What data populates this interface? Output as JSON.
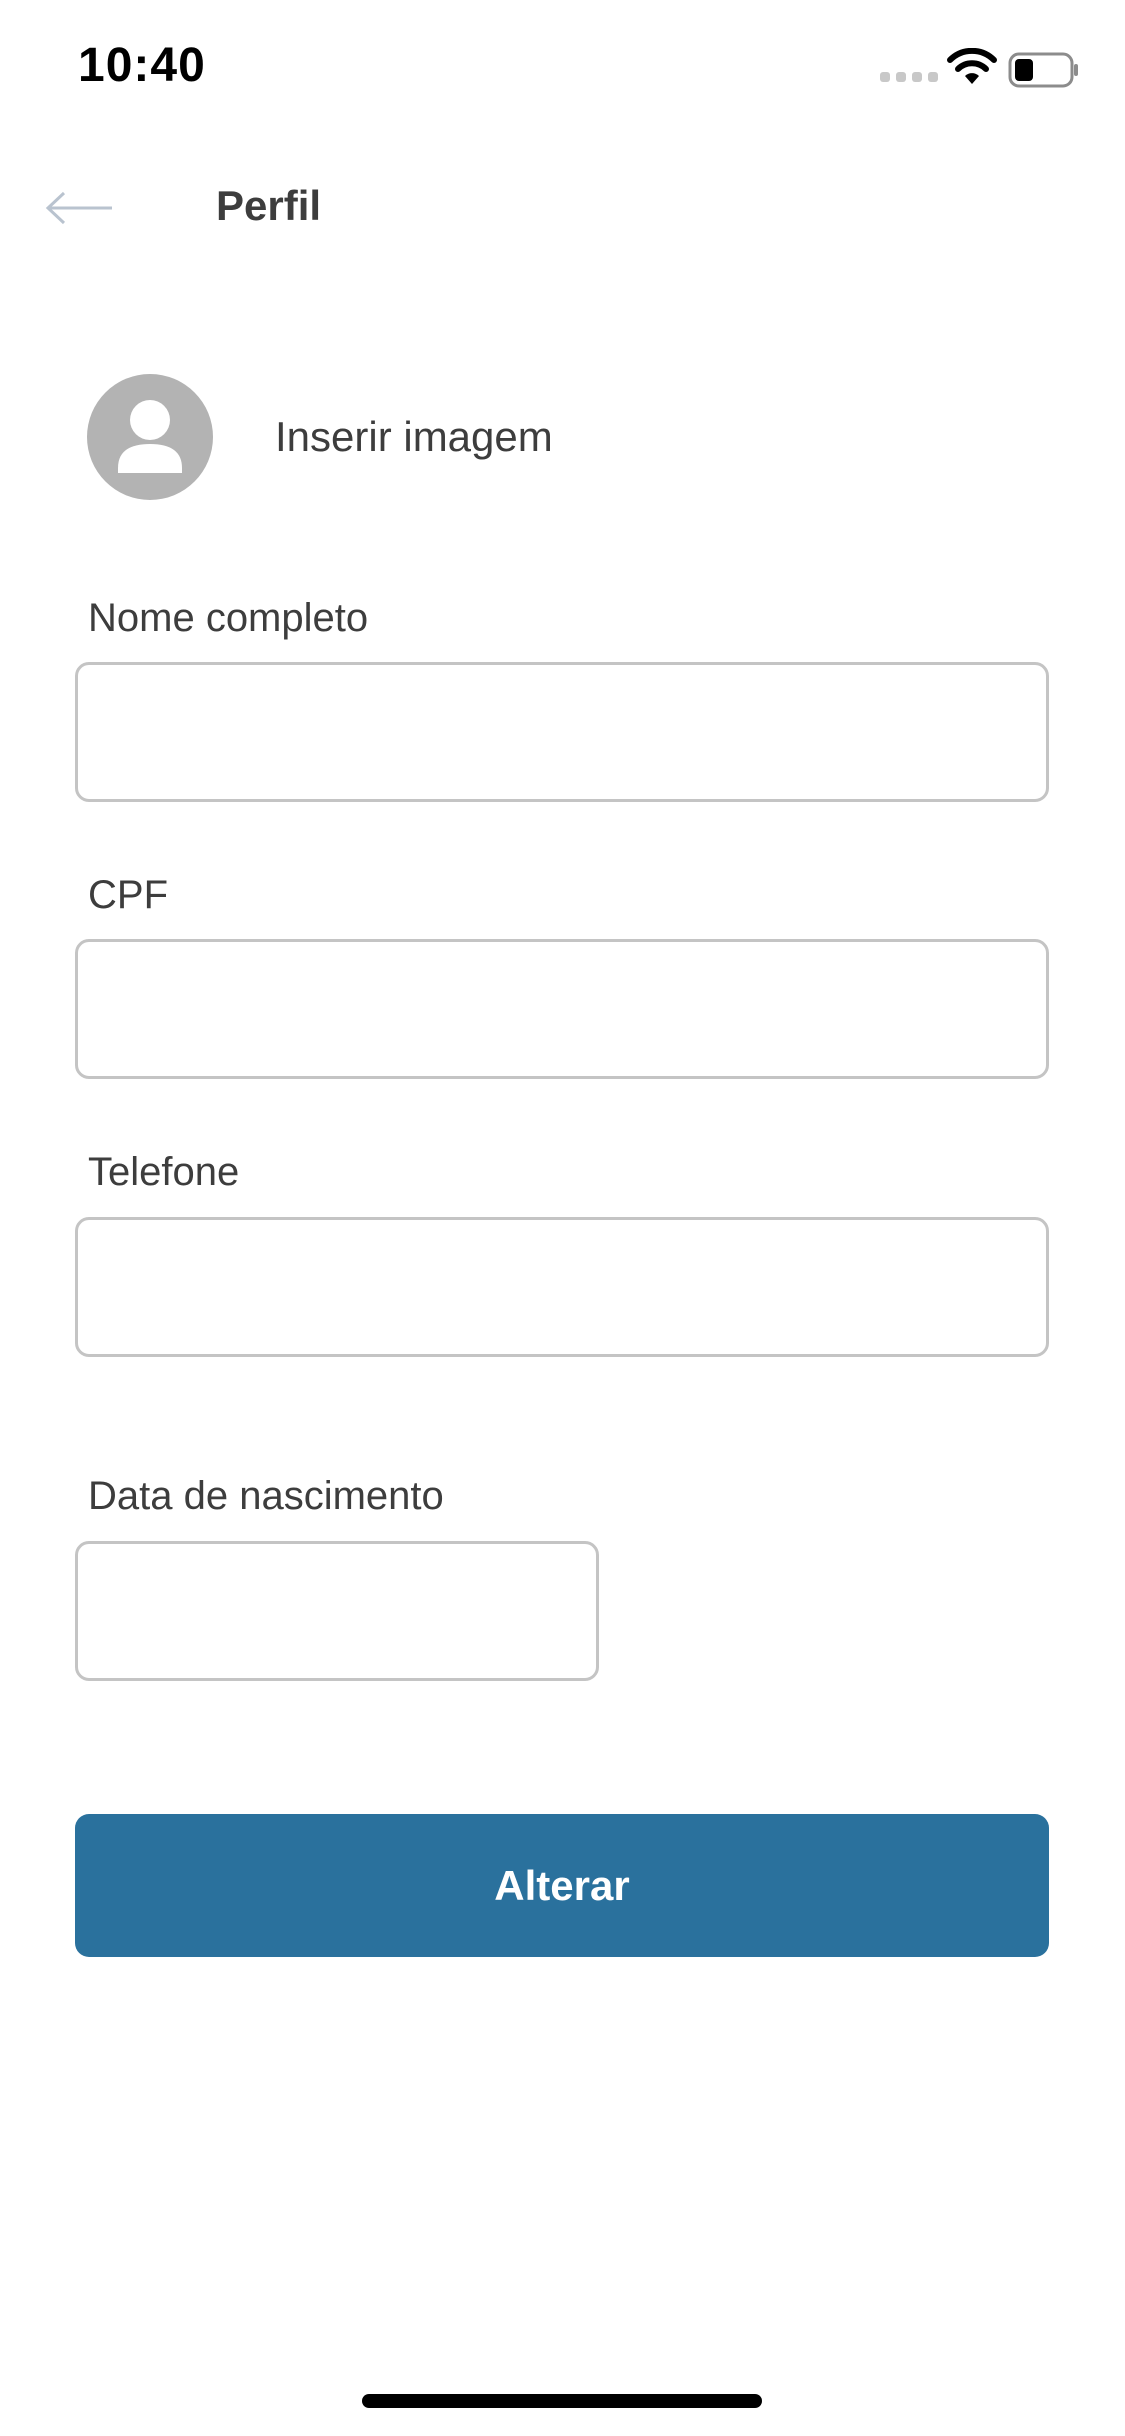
{
  "status_bar": {
    "time": "10:40",
    "icons": [
      "cellular-signal-icon",
      "wifi-icon",
      "battery-icon"
    ],
    "battery_level": 0.35
  },
  "header": {
    "back_icon": "arrow-left-icon",
    "title": "Perfil"
  },
  "avatar": {
    "icon": "user-silhouette-icon",
    "label": "Inserir imagem"
  },
  "form": {
    "full_name": {
      "label": "Nome completo",
      "value": ""
    },
    "cpf": {
      "label": "CPF",
      "value": ""
    },
    "phone": {
      "label": "Telefone",
      "value": ""
    },
    "birth_date": {
      "label": "Data de nascimento",
      "value": ""
    }
  },
  "actions": {
    "submit_label": "Alterar"
  },
  "colors": {
    "primary": "#2a719d",
    "text": "#3d3d3d",
    "input_border": "#c4c4c4",
    "avatar_bg": "#b3b3b3",
    "back_arrow": "#b9c3cf"
  }
}
